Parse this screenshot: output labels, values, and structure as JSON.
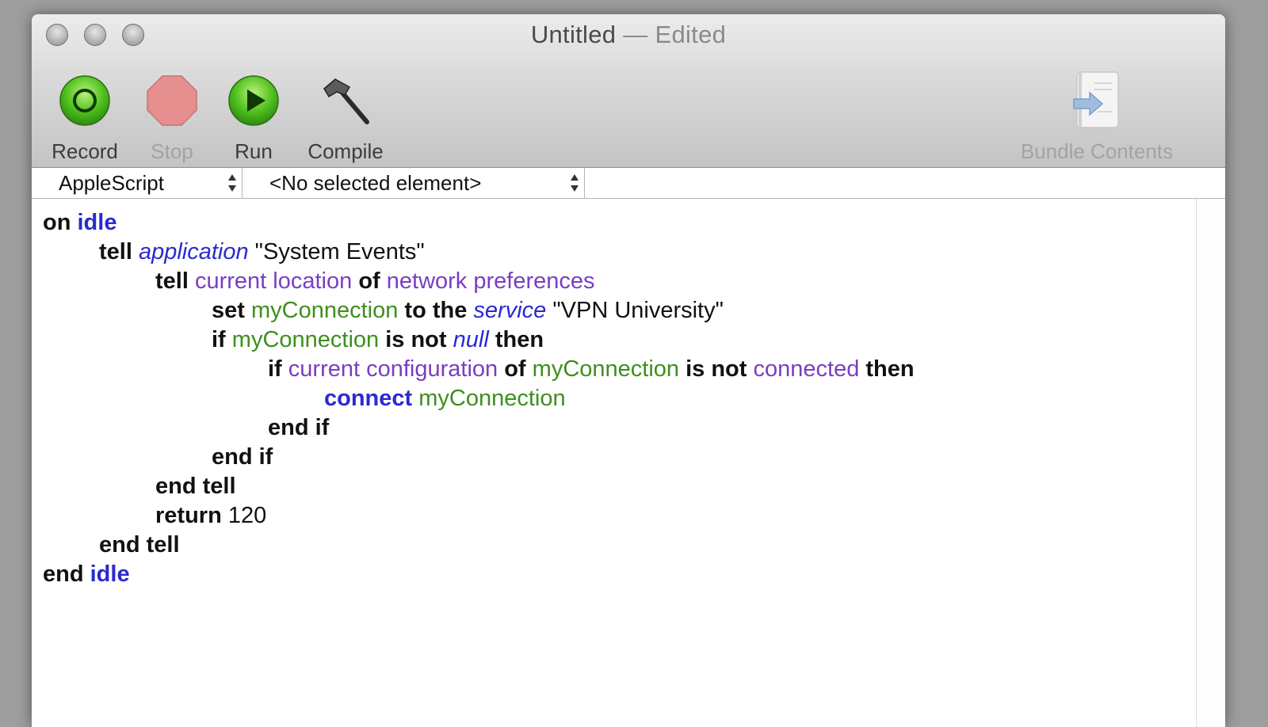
{
  "window": {
    "title": "Untitled",
    "title_suffix": "— Edited"
  },
  "toolbar": {
    "record_label": "Record",
    "stop_label": "Stop",
    "run_label": "Run",
    "compile_label": "Compile",
    "bundle_label": "Bundle Contents"
  },
  "selectors": {
    "language": "AppleScript",
    "element": "<No selected element>"
  },
  "colors": {
    "keyword": "#111111",
    "command": "#2a2ad0",
    "class": "#2a2ad0",
    "property": "#7a3ec1",
    "variable": "#3e8f1e"
  },
  "code": {
    "lines": [
      {
        "indent": 0,
        "tokens": [
          {
            "t": "on",
            "c": "kw"
          },
          {
            "t": " ",
            "c": ""
          },
          {
            "t": "idle",
            "c": "blue"
          }
        ]
      },
      {
        "indent": 1,
        "tokens": [
          {
            "t": "tell",
            "c": "kw"
          },
          {
            "t": " ",
            "c": ""
          },
          {
            "t": "application",
            "c": "cls"
          },
          {
            "t": " \"System Events\"",
            "c": "str"
          }
        ]
      },
      {
        "indent": 2,
        "tokens": [
          {
            "t": "tell",
            "c": "kw"
          },
          {
            "t": " ",
            "c": ""
          },
          {
            "t": "current location",
            "c": "prop"
          },
          {
            "t": " ",
            "c": ""
          },
          {
            "t": "of",
            "c": "kw"
          },
          {
            "t": " ",
            "c": ""
          },
          {
            "t": "network preferences",
            "c": "prop"
          }
        ]
      },
      {
        "indent": 3,
        "tokens": [
          {
            "t": "set",
            "c": "kw"
          },
          {
            "t": " ",
            "c": ""
          },
          {
            "t": "myConnection",
            "c": "var"
          },
          {
            "t": " ",
            "c": ""
          },
          {
            "t": "to the",
            "c": "kw"
          },
          {
            "t": " ",
            "c": ""
          },
          {
            "t": "service",
            "c": "cls"
          },
          {
            "t": " \"VPN University\"",
            "c": "str"
          }
        ]
      },
      {
        "indent": 3,
        "tokens": [
          {
            "t": "if",
            "c": "kw"
          },
          {
            "t": " ",
            "c": ""
          },
          {
            "t": "myConnection",
            "c": "var"
          },
          {
            "t": " ",
            "c": ""
          },
          {
            "t": "is not",
            "c": "kw"
          },
          {
            "t": " ",
            "c": ""
          },
          {
            "t": "null",
            "c": "cls"
          },
          {
            "t": " ",
            "c": ""
          },
          {
            "t": "then",
            "c": "kw"
          }
        ]
      },
      {
        "indent": 4,
        "tokens": [
          {
            "t": "if",
            "c": "kw"
          },
          {
            "t": " ",
            "c": ""
          },
          {
            "t": "current configuration",
            "c": "prop"
          },
          {
            "t": " ",
            "c": ""
          },
          {
            "t": "of",
            "c": "kw"
          },
          {
            "t": " ",
            "c": ""
          },
          {
            "t": "myConnection",
            "c": "var"
          },
          {
            "t": " ",
            "c": ""
          },
          {
            "t": "is not",
            "c": "kw"
          },
          {
            "t": " ",
            "c": ""
          },
          {
            "t": "connected",
            "c": "prop"
          },
          {
            "t": " ",
            "c": ""
          },
          {
            "t": "then",
            "c": "kw"
          }
        ]
      },
      {
        "indent": 5,
        "tokens": [
          {
            "t": "connect",
            "c": "blue"
          },
          {
            "t": " ",
            "c": ""
          },
          {
            "t": "myConnection",
            "c": "var"
          }
        ]
      },
      {
        "indent": 4,
        "tokens": [
          {
            "t": "end if",
            "c": "kw"
          }
        ]
      },
      {
        "indent": 3,
        "tokens": [
          {
            "t": "end if",
            "c": "kw"
          }
        ]
      },
      {
        "indent": 2,
        "tokens": [
          {
            "t": "end tell",
            "c": "kw"
          }
        ]
      },
      {
        "indent": 2,
        "tokens": [
          {
            "t": "return",
            "c": "kw"
          },
          {
            "t": " 120",
            "c": "str"
          }
        ]
      },
      {
        "indent": 1,
        "tokens": [
          {
            "t": "end tell",
            "c": "kw"
          }
        ]
      },
      {
        "indent": 0,
        "tokens": [
          {
            "t": "end",
            "c": "kw"
          },
          {
            "t": " ",
            "c": ""
          },
          {
            "t": "idle",
            "c": "blue"
          }
        ]
      }
    ]
  }
}
